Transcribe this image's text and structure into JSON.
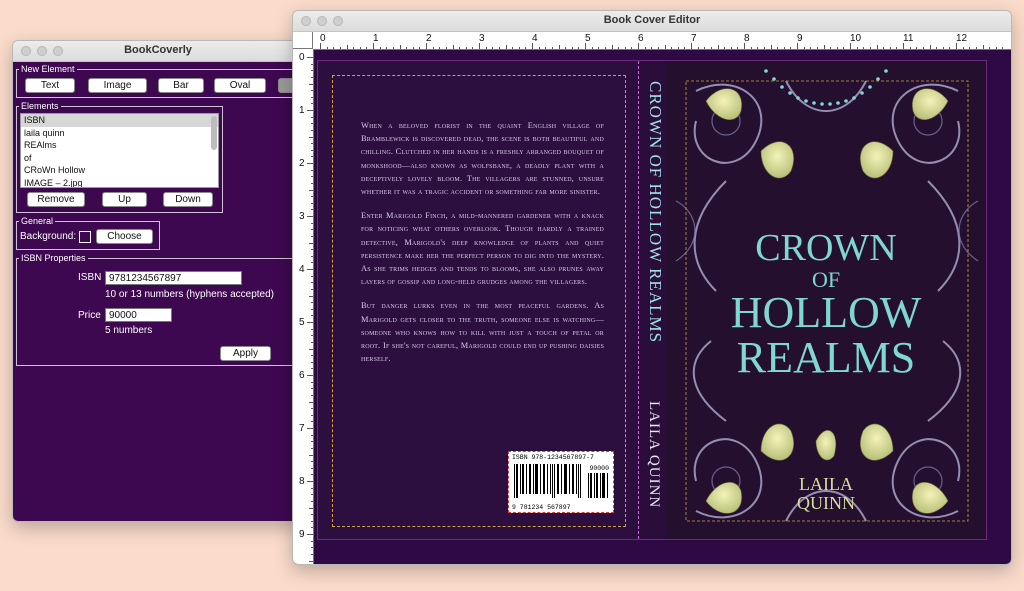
{
  "panel": {
    "title": "BookCoverly",
    "new_element": {
      "legend": "New Element",
      "buttons": [
        "Text",
        "Image",
        "Bar",
        "Oval"
      ]
    },
    "elements": {
      "legend": "Elements",
      "items": [
        "ISBN",
        "laila quinn",
        "REAlms",
        "of",
        "CRoWn Hollow",
        "IMAGE – 2.jpg"
      ],
      "selected": "ISBN",
      "remove_label": "Remove",
      "up_label": "Up",
      "down_label": "Down"
    },
    "general": {
      "legend": "General",
      "background_label": "Background:",
      "choose_label": "Choose"
    },
    "isbn_properties": {
      "legend": "ISBN Properties",
      "isbn_label": "ISBN",
      "isbn_value": "9781234567897",
      "isbn_hint": "10 or 13 numbers (hyphens accepted)",
      "price_label": "Price",
      "price_value": "90000",
      "price_hint": "5 numbers",
      "apply_label": "Apply"
    }
  },
  "editor": {
    "title": "Book Cover Editor",
    "ruler_h": [
      "0",
      "1",
      "2",
      "3",
      "4",
      "5",
      "6",
      "7",
      "8",
      "9",
      "10",
      "11",
      "12"
    ],
    "ruler_v": [
      "0",
      "1",
      "2",
      "3",
      "4",
      "5",
      "6",
      "7",
      "8",
      "9"
    ],
    "back_cover": {
      "paragraphs": [
        "When a beloved florist in the quaint English village of Bramblewick is discovered dead, the scene is both beautiful and chilling. Clutched in her hands is a freshly arranged bouquet of monkshood—also known as wolfsbane, a deadly plant with a deceptively lovely bloom. The villagers are stunned, unsure whether it was a tragic accident or something far more sinister.",
        "Enter Marigold Finch, a mild-mannered gardener with a knack for noticing what others overlook. Though hardly a trained detective, Marigold's deep knowledge of plants and quiet persistence make her the perfect person to dig into the mystery. As she trims hedges and tends to blooms, she also prunes away layers of gossip and long-held grudges among the villagers.",
        "But danger lurks even in the most peaceful gardens. As Marigold gets closer to the truth, someone else is watching—someone who knows how to kill with just a touch of petal or root. If she's not careful, Marigold could end up pushing daisies herself."
      ],
      "barcode": {
        "isbn_text": "ISBN 978-1234567897-7",
        "price": "90000",
        "digits": "9 781234 567897"
      }
    },
    "spine": {
      "title": "CROWN OF HOLLOW REALMS",
      "author": "LAILA QUINN"
    },
    "front_cover": {
      "title_line1": "CROWN",
      "title_line2": "OF",
      "title_line3": "HOLLOW",
      "title_line4": "REALMS",
      "author_line1": "LAILA",
      "author_line2": "QUINN"
    },
    "colors": {
      "cover_bg": "#2a0d3a",
      "title_teal": "#7fd6d3",
      "author_gold": "#d8dd9d",
      "panel_bg": "#3d0850"
    }
  }
}
